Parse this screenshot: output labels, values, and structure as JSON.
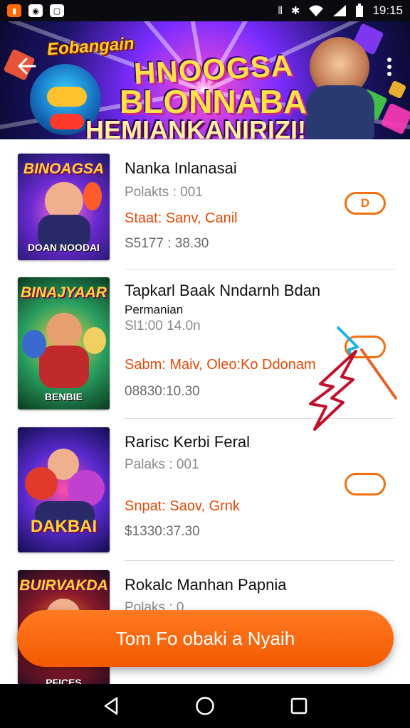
{
  "status_bar": {
    "time": "19:15",
    "icons": [
      "app-icon",
      "app-icon",
      "app-icon",
      "vibrate-icon",
      "bluetooth-icon",
      "wifi-icon",
      "signal-icon",
      "battery-icon"
    ]
  },
  "banner": {
    "tag": "Eobangain",
    "title_line_1": "HNOOGSA",
    "title_line_2": "BLONNABA",
    "title_line_3": "HEMIANKANIRIZI!"
  },
  "items": [
    {
      "thumb_title": "BINOAGSA",
      "thumb_sub": "DOAN NOODAI",
      "title": "Nanka Inlanasai",
      "meta": "Polakts : 001",
      "status": "Staat: Sanv, Canil",
      "price": "S5177 : 38.30",
      "toggle_label": "D"
    },
    {
      "thumb_title": "BINAJYAAR",
      "thumb_sub": "BENBIE",
      "title": "Tapkarl Baak Nndarnh Bdan",
      "subtitle": "Permanian",
      "meta": "Sl1:00 14.0n",
      "status": "Sabm: Maiv, Oleo:Ko Ddonam",
      "price": "08830:10.30",
      "toggle_label": ""
    },
    {
      "thumb_title": "",
      "thumb_sub": "DAKBAI",
      "title": "Rarisc Kerbi Feral",
      "meta": "Palaks : 001",
      "status": "Snpat: Saov, Grnk",
      "price": "$1330:37.30",
      "toggle_label": ""
    },
    {
      "thumb_title": "BUIRVAKDA",
      "thumb_sub": "PFICES",
      "title": "Rokalc Manhan Papnia",
      "meta": "Polaks : 0",
      "status": "",
      "price": "",
      "toggle_label": ""
    }
  ],
  "cta": {
    "label": "Tom Fo obaki a Nyaih"
  },
  "colors": {
    "accent": "#f35a00",
    "status_orange": "#e04a0a",
    "divider": "#dadada"
  }
}
